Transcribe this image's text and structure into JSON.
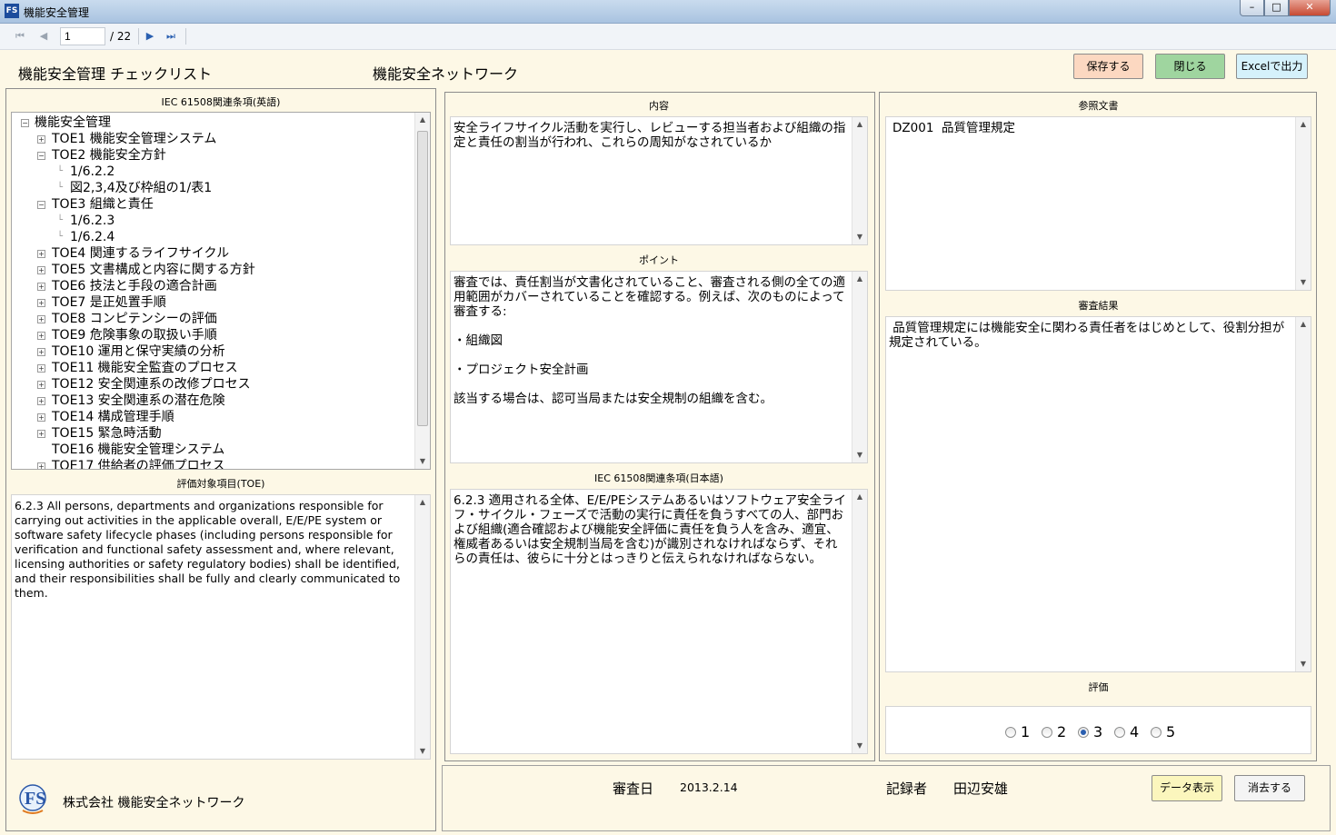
{
  "window": {
    "title": "機能安全管理",
    "icon_text": "FS"
  },
  "toolbar": {
    "page_current": "1",
    "page_total": "/ 22"
  },
  "header": {
    "title": "機能安全管理 チェックリスト",
    "company": "機能安全ネットワーク",
    "save_label": "保存する",
    "close_label": "閉じる",
    "excel_label": "Excelで出力"
  },
  "left": {
    "tree_label": "IEC 61508関連条項(英語)",
    "tree": [
      {
        "label": "機能安全管理",
        "level": 0,
        "toggle": "−"
      },
      {
        "label": "TOE1 機能安全管理システム",
        "level": 1,
        "toggle": "+"
      },
      {
        "label": "TOE2 機能安全方針",
        "level": 1,
        "toggle": "−"
      },
      {
        "label": "1/6.2.2",
        "level": 2,
        "toggle": ""
      },
      {
        "label": "図2,3,4及び枠組の1/表1",
        "level": 2,
        "toggle": ""
      },
      {
        "label": "TOE3 組織と責任",
        "level": 1,
        "toggle": "−"
      },
      {
        "label": "1/6.2.3",
        "level": 2,
        "toggle": ""
      },
      {
        "label": "1/6.2.4",
        "level": 2,
        "toggle": ""
      },
      {
        "label": "TOE4 関連するライフサイクル",
        "level": 1,
        "toggle": "+"
      },
      {
        "label": "TOE5 文書構成と内容に関する方針",
        "level": 1,
        "toggle": "+"
      },
      {
        "label": "TOE6 技法と手段の適合計画",
        "level": 1,
        "toggle": "+"
      },
      {
        "label": "TOE7 是正処置手順",
        "level": 1,
        "toggle": "+"
      },
      {
        "label": "TOE8 コンピテンシーの評価",
        "level": 1,
        "toggle": "+"
      },
      {
        "label": "TOE9 危険事象の取扱い手順",
        "level": 1,
        "toggle": "+"
      },
      {
        "label": "TOE10 運用と保守実績の分析",
        "level": 1,
        "toggle": "+"
      },
      {
        "label": "TOE11 機能安全監査のプロセス",
        "level": 1,
        "toggle": "+"
      },
      {
        "label": "TOE12 安全関連系の改修プロセス",
        "level": 1,
        "toggle": "+"
      },
      {
        "label": "TOE13 安全関連系の潜在危険",
        "level": 1,
        "toggle": "+"
      },
      {
        "label": "TOE14 構成管理手順",
        "level": 1,
        "toggle": "+"
      },
      {
        "label": "TOE15 緊急時活動",
        "level": 1,
        "toggle": "+"
      },
      {
        "label": "TOE16 機能安全管理システム",
        "level": 1,
        "toggle": ""
      },
      {
        "label": "TOE17 供給者の評価プロセス",
        "level": 1,
        "toggle": "+"
      }
    ],
    "toe_label": "評価対象項目(TOE)",
    "toe_text": "6.2.3 All persons, departments and organizations responsible for carrying out activities in the applicable overall, E/E/PE system or software safety lifecycle phases (including persons responsible for verification and functional safety assessment and, where relevant, licensing authorities or safety regulatory bodies) shall be identified, and their responsibilities shall be fully and clearly communicated to them.",
    "company_name": "株式会社 機能安全ネットワーク"
  },
  "middle": {
    "content_label": "内容",
    "content_text": "安全ライフサイクル活動を実行し、レビューする担当者および組織の指定と責任の割当が行われ、これらの周知がなされているか",
    "point_label": "ポイント",
    "point_text": "審査では、責任割当が文書化されていること、審査される側の全ての適用範囲がカバーされていることを確認する。例えば、次のものによって審査する:\n\n・組織図\n\n・プロジェクト安全計画\n\n該当する場合は、認可当局または安全規制の組織を含む。",
    "iec_jp_label": "IEC 61508関連条項(日本語)",
    "iec_jp_text": "6.2.3 適用される全体、E/E/PEシステムあるいはソフトウェア安全ライフ・サイクル・フェーズで活動の実行に責任を負うすべての人、部門および組織(適合確認および機能安全評価に責任を負う人を含み、適宜、権威者あるいは安全規制当局を含む)が識別されなければならず、それらの責任は、彼らに十分とはっきりと伝えられなければならない。"
  },
  "right": {
    "ref_label": "参照文書",
    "ref_text": "DZ001  品質管理規定",
    "result_label": "審査結果",
    "result_text": " 品質管理規定には機能安全に関わる責任者をはじめとして、役割分担が規定されている。",
    "rating_label": "評価",
    "rating_options": [
      "1",
      "2",
      "3",
      "4",
      "5"
    ],
    "rating_selected": 3
  },
  "footer": {
    "review_date_label": "審査日",
    "review_date": "2013.2.14",
    "recorder_label": "記録者",
    "recorder": "田辺安雄",
    "data_label": "データ表示",
    "erase_label": "消去する"
  }
}
